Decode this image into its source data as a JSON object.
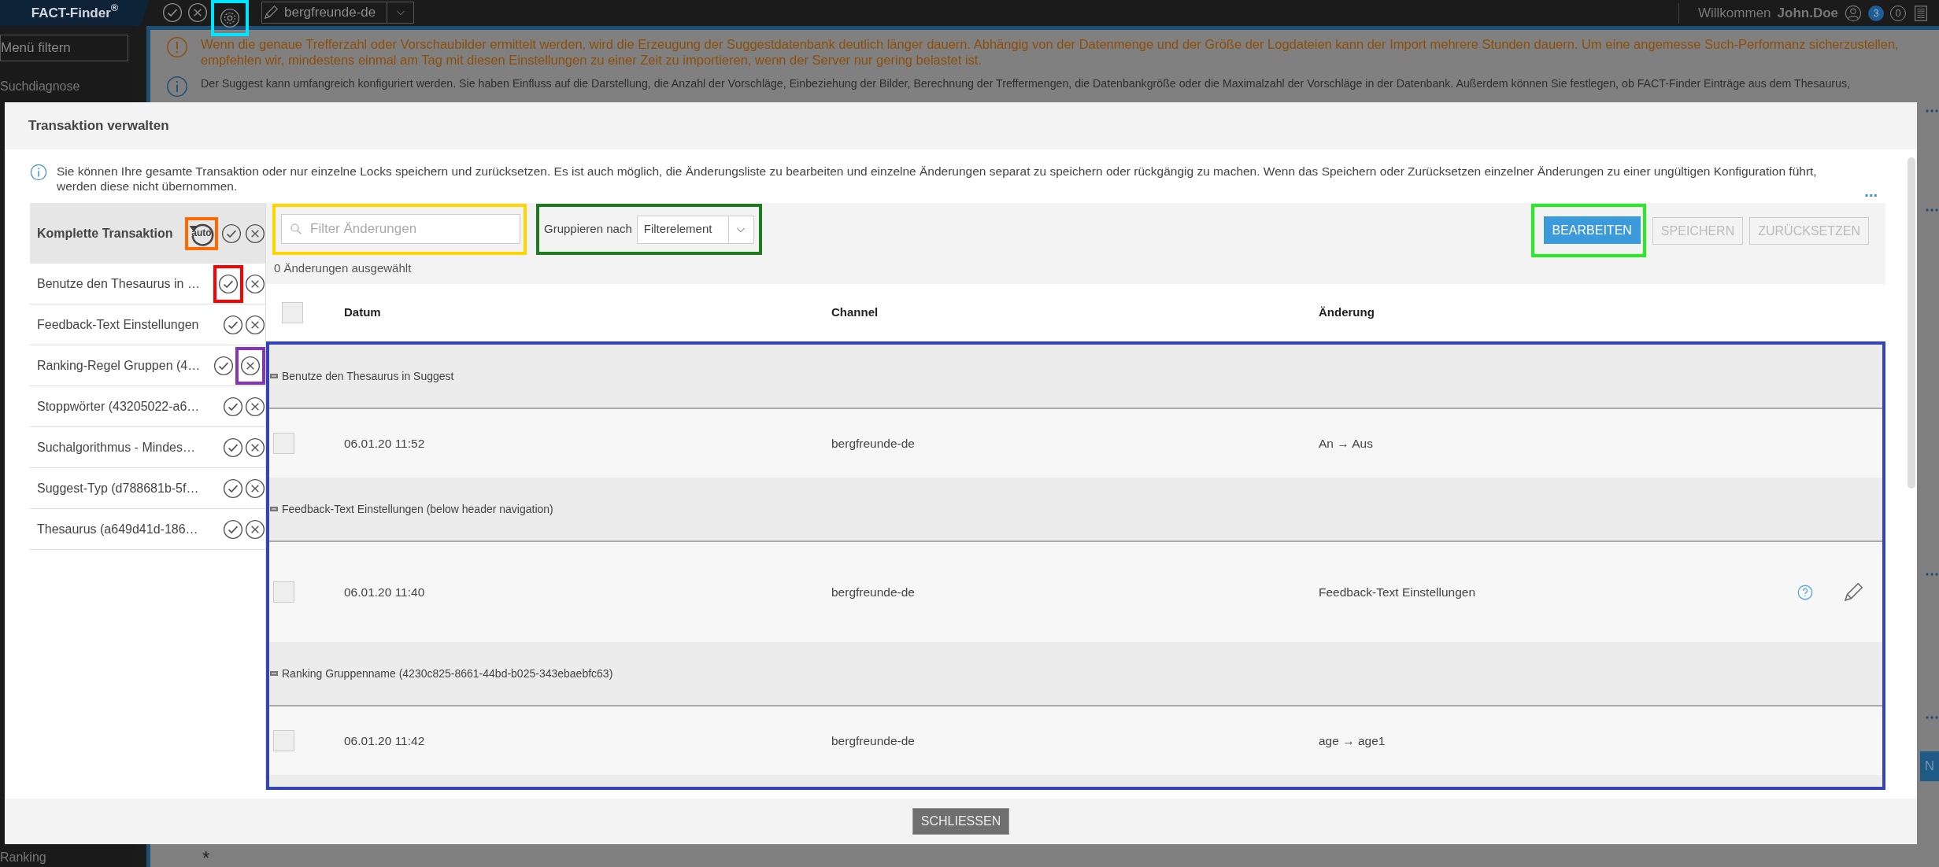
{
  "top_bar": {
    "logo": "FACT-Finder$^{®}$",
    "tools": [
      {
        "kind": "check"
      },
      {
        "kind": "close"
      },
      {
        "kind": "settings",
        "highlight": {
          "color": "#00e5ff"
        }
      }
    ],
    "channel": "bergfreunde-de",
    "welcome": "Willkommen",
    "user": "John.Doe",
    "notifications": "3",
    "messages": "0"
  },
  "sidebar": {
    "filter_placeholder": "Menü filtern",
    "items": [
      "Suchdiagnose",
      "Ranking"
    ]
  },
  "background": {
    "warning": "Wenn die genaue Trefferzahl oder Vorschaubilder ermittelt werden, wird die Erzeugung der Suggestdatenbank deutlich länger dauern. Abhängig von der Datenmenge und der Größe der Logdateien kann der Import mehrere Stunden dauern. Um eine angemesse Such-Performanz sicherzustellen, empfehlen wir, mindestens einmal am Tag mit diesen Einstellungen zu einer Zeit zu importieren, wenn der Server nur gering belastet ist.",
    "info": "Der Suggest kann umfangreich konfiguriert werden. Sie haben Einfluss auf die Darstellung, die Anzahl der Vorschläge, Einbeziehung der Bilder, Berechnung der Treffermengen, die Datenbankgröße oder die Maximalzahl der Vorschläge in der Datenbank. Außerdem können Sie festlegen, ob FACT-Finder Einträge aus dem Thesaurus,",
    "required_mark": "*",
    "button_fragment": "N"
  },
  "dialog": {
    "title": "Transaktion verwalten",
    "info": "Sie können Ihre gesamte Transaktion oder nur einzelne Locks speichern und zurücksetzen. Es ist auch möglich, die Änderungsliste zu bearbeiten und einzelne Änderungen separat zu speichern oder rückgängig zu machen. Wenn das Speichern oder Zurücksetzen einzelner Änderungen zu einer ungültigen Konfiguration führt, werden diese nicht übernommen.",
    "more": "...",
    "transaction": {
      "title": "Komplette Transaktion",
      "reset_label": "auto",
      "reset_highlight": {
        "color": "#ff6a00"
      }
    },
    "locks": [
      {
        "label": "Benutze den Thesaurus in …",
        "save_highlight": {
          "color": "#ff0000"
        }
      },
      {
        "label": "Feedback-Text Einstellungen"
      },
      {
        "label": "Ranking-Regel Gruppen (4…",
        "discard_highlight": {
          "color": "#8833bb"
        }
      },
      {
        "label": "Stoppwörter (43205022-a6…"
      },
      {
        "label": "Suchalgorithmus - Mindes…"
      },
      {
        "label": "Suggest-Typ (d788681b-5f…"
      },
      {
        "label": "Thesaurus (a649d41d-186…"
      }
    ],
    "filter": {
      "placeholder": "Filter Änderungen",
      "highlight": {
        "color": "#ffd400"
      }
    },
    "selected_count": "0 Änderungen ausgewählt",
    "group_by": {
      "label": "Gruppieren nach",
      "value": "Filterelement",
      "highlight": {
        "color": "#1e7a1e"
      }
    },
    "buttons": [
      {
        "label": "BEARBEITEN",
        "disabled": false,
        "highlight": {
          "color": "#22ee22"
        }
      },
      {
        "label": "SPEICHERN",
        "disabled": true
      },
      {
        "label": "ZURÜCKSETZEN",
        "disabled": true
      }
    ],
    "all_checked": false,
    "columns": [
      "Datum",
      "Channel",
      "Änderung"
    ],
    "groups_highlight": {
      "color": "#3344bb"
    },
    "groups": [
      {
        "title": "Benutze den Thesaurus in Suggest",
        "rows": [
          {
            "checked": false,
            "date": "06.01.20 11:52",
            "channel": "bergfreunde-de",
            "change": "An → Aus",
            "help": false,
            "editable": false
          }
        ]
      },
      {
        "title": "Feedback-Text Einstellungen (below header navigation)",
        "rows": [
          {
            "checked": false,
            "date": "06.01.20 11:40",
            "channel": "bergfreunde-de",
            "change": "Feedback-Text Einstellungen",
            "help": true,
            "editable": true
          }
        ]
      },
      {
        "title": "Ranking Gruppenname (4230c825-8661-44bd-b025-343ebaebfc63)",
        "rows": [
          {
            "checked": false,
            "date": "06.01.20 11:42",
            "channel": "bergfreunde-de",
            "change": "age → age1",
            "help": false,
            "editable": false
          }
        ]
      }
    ],
    "close": "SCHLIESSEN"
  }
}
